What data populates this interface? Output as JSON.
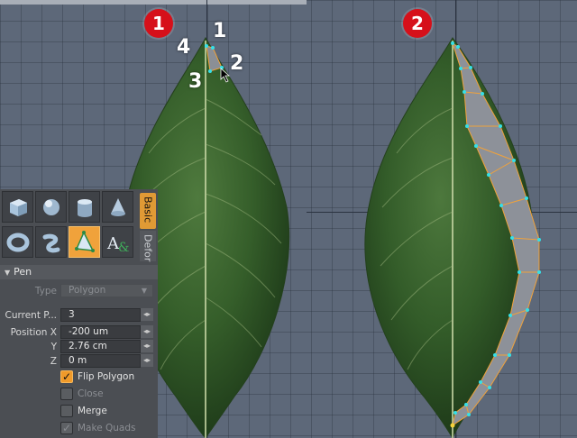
{
  "annotations": {
    "badge_left": "1",
    "badge_right": "2",
    "vertex_labels": [
      "1",
      "2",
      "3",
      "4"
    ]
  },
  "tabs": {
    "basic": "Basic",
    "deform": "Defor"
  },
  "tools": [
    {
      "icon": "cube-icon"
    },
    {
      "icon": "sphere-icon"
    },
    {
      "icon": "cylinder-icon"
    },
    {
      "icon": "cone-icon"
    },
    {
      "icon": "torus-icon"
    },
    {
      "icon": "tube-icon"
    },
    {
      "icon": "pen-icon",
      "active": true
    },
    {
      "icon": "text-tool-icon"
    }
  ],
  "pen": {
    "title": "Pen",
    "type_label": "Type",
    "type_value": "Polygon",
    "current_label": "Current P...",
    "current_value": "3",
    "position_x_label": "Position X",
    "position_x": "-200 um",
    "y_label": "Y",
    "position_y": "2.76 cm",
    "z_label": "Z",
    "position_z": "0 m",
    "flip_polygon": "Flip Polygon",
    "close": "Close",
    "merge": "Merge",
    "make_quads": "Make Quads"
  },
  "colors": {
    "accent": "#f0a23b",
    "badge": "#d6101a",
    "viewport": "#5d6879",
    "panel": "#4b4e53"
  }
}
